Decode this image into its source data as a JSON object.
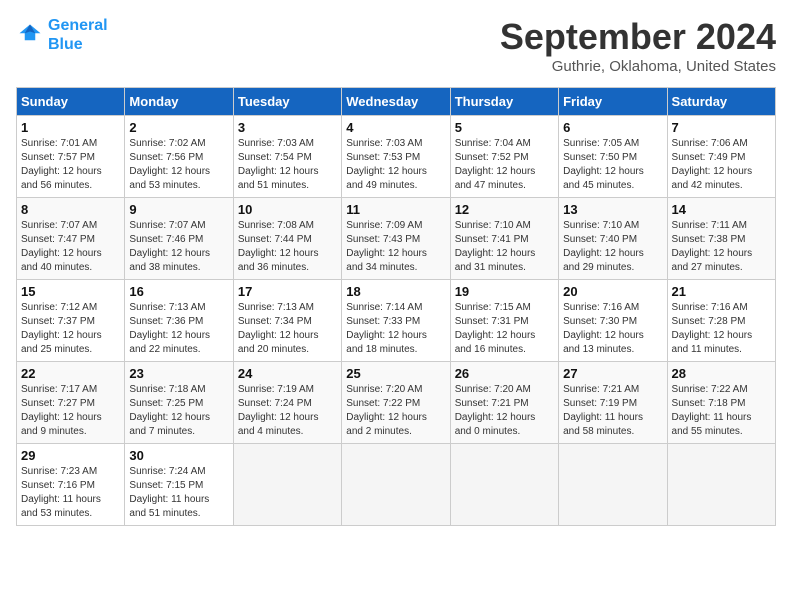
{
  "logo": {
    "line1": "General",
    "line2": "Blue"
  },
  "title": "September 2024",
  "location": "Guthrie, Oklahoma, United States",
  "weekdays": [
    "Sunday",
    "Monday",
    "Tuesday",
    "Wednesday",
    "Thursday",
    "Friday",
    "Saturday"
  ],
  "weeks": [
    [
      {
        "day": "1",
        "info": "Sunrise: 7:01 AM\nSunset: 7:57 PM\nDaylight: 12 hours\nand 56 minutes."
      },
      {
        "day": "2",
        "info": "Sunrise: 7:02 AM\nSunset: 7:56 PM\nDaylight: 12 hours\nand 53 minutes."
      },
      {
        "day": "3",
        "info": "Sunrise: 7:03 AM\nSunset: 7:54 PM\nDaylight: 12 hours\nand 51 minutes."
      },
      {
        "day": "4",
        "info": "Sunrise: 7:03 AM\nSunset: 7:53 PM\nDaylight: 12 hours\nand 49 minutes."
      },
      {
        "day": "5",
        "info": "Sunrise: 7:04 AM\nSunset: 7:52 PM\nDaylight: 12 hours\nand 47 minutes."
      },
      {
        "day": "6",
        "info": "Sunrise: 7:05 AM\nSunset: 7:50 PM\nDaylight: 12 hours\nand 45 minutes."
      },
      {
        "day": "7",
        "info": "Sunrise: 7:06 AM\nSunset: 7:49 PM\nDaylight: 12 hours\nand 42 minutes."
      }
    ],
    [
      {
        "day": "8",
        "info": "Sunrise: 7:07 AM\nSunset: 7:47 PM\nDaylight: 12 hours\nand 40 minutes."
      },
      {
        "day": "9",
        "info": "Sunrise: 7:07 AM\nSunset: 7:46 PM\nDaylight: 12 hours\nand 38 minutes."
      },
      {
        "day": "10",
        "info": "Sunrise: 7:08 AM\nSunset: 7:44 PM\nDaylight: 12 hours\nand 36 minutes."
      },
      {
        "day": "11",
        "info": "Sunrise: 7:09 AM\nSunset: 7:43 PM\nDaylight: 12 hours\nand 34 minutes."
      },
      {
        "day": "12",
        "info": "Sunrise: 7:10 AM\nSunset: 7:41 PM\nDaylight: 12 hours\nand 31 minutes."
      },
      {
        "day": "13",
        "info": "Sunrise: 7:10 AM\nSunset: 7:40 PM\nDaylight: 12 hours\nand 29 minutes."
      },
      {
        "day": "14",
        "info": "Sunrise: 7:11 AM\nSunset: 7:38 PM\nDaylight: 12 hours\nand 27 minutes."
      }
    ],
    [
      {
        "day": "15",
        "info": "Sunrise: 7:12 AM\nSunset: 7:37 PM\nDaylight: 12 hours\nand 25 minutes."
      },
      {
        "day": "16",
        "info": "Sunrise: 7:13 AM\nSunset: 7:36 PM\nDaylight: 12 hours\nand 22 minutes."
      },
      {
        "day": "17",
        "info": "Sunrise: 7:13 AM\nSunset: 7:34 PM\nDaylight: 12 hours\nand 20 minutes."
      },
      {
        "day": "18",
        "info": "Sunrise: 7:14 AM\nSunset: 7:33 PM\nDaylight: 12 hours\nand 18 minutes."
      },
      {
        "day": "19",
        "info": "Sunrise: 7:15 AM\nSunset: 7:31 PM\nDaylight: 12 hours\nand 16 minutes."
      },
      {
        "day": "20",
        "info": "Sunrise: 7:16 AM\nSunset: 7:30 PM\nDaylight: 12 hours\nand 13 minutes."
      },
      {
        "day": "21",
        "info": "Sunrise: 7:16 AM\nSunset: 7:28 PM\nDaylight: 12 hours\nand 11 minutes."
      }
    ],
    [
      {
        "day": "22",
        "info": "Sunrise: 7:17 AM\nSunset: 7:27 PM\nDaylight: 12 hours\nand 9 minutes."
      },
      {
        "day": "23",
        "info": "Sunrise: 7:18 AM\nSunset: 7:25 PM\nDaylight: 12 hours\nand 7 minutes."
      },
      {
        "day": "24",
        "info": "Sunrise: 7:19 AM\nSunset: 7:24 PM\nDaylight: 12 hours\nand 4 minutes."
      },
      {
        "day": "25",
        "info": "Sunrise: 7:20 AM\nSunset: 7:22 PM\nDaylight: 12 hours\nand 2 minutes."
      },
      {
        "day": "26",
        "info": "Sunrise: 7:20 AM\nSunset: 7:21 PM\nDaylight: 12 hours\nand 0 minutes."
      },
      {
        "day": "27",
        "info": "Sunrise: 7:21 AM\nSunset: 7:19 PM\nDaylight: 11 hours\nand 58 minutes."
      },
      {
        "day": "28",
        "info": "Sunrise: 7:22 AM\nSunset: 7:18 PM\nDaylight: 11 hours\nand 55 minutes."
      }
    ],
    [
      {
        "day": "29",
        "info": "Sunrise: 7:23 AM\nSunset: 7:16 PM\nDaylight: 11 hours\nand 53 minutes."
      },
      {
        "day": "30",
        "info": "Sunrise: 7:24 AM\nSunset: 7:15 PM\nDaylight: 11 hours\nand 51 minutes."
      },
      {
        "day": "",
        "info": ""
      },
      {
        "day": "",
        "info": ""
      },
      {
        "day": "",
        "info": ""
      },
      {
        "day": "",
        "info": ""
      },
      {
        "day": "",
        "info": ""
      }
    ]
  ]
}
